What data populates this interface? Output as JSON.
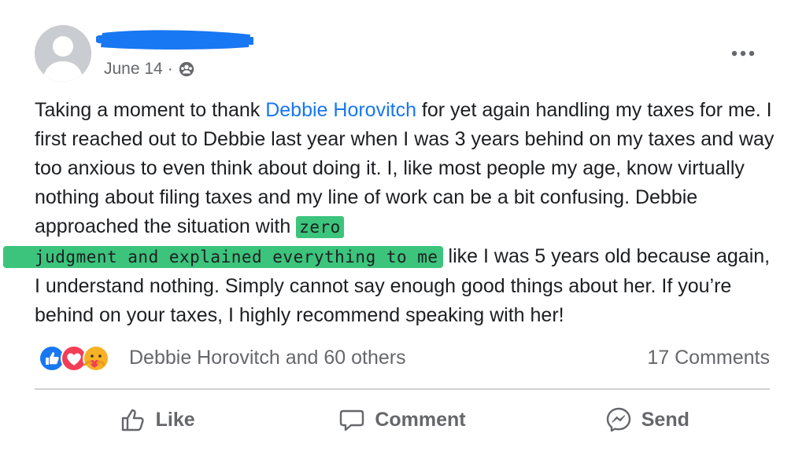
{
  "post": {
    "date": "June 14",
    "separator": "·",
    "text_parts": {
      "p1": "Taking a moment to thank ",
      "mention": "Debbie Horovitch",
      "p2": " for yet again handling my taxes for me. I first reached out to Debbie last year when I was 3 years behind on my taxes and way too anxious to even think about doing it. I, like most people my age, know virtually nothing about filing taxes and my line of work can be a bit confusing. Debbie approached the situation with ",
      "highlight1": "zero",
      "highlight2": "judgment and explained everything to me",
      "p3": " like I was 5 years old because again, I understand nothing.  Simply cannot say enough good things about her. If you’re behind on your taxes, I highly recommend speaking with her!"
    }
  },
  "reactions": {
    "names": "Debbie Horovitch and 60 others",
    "comments": "17 Comments",
    "types": [
      "like",
      "love",
      "care"
    ]
  },
  "actions": {
    "like": "Like",
    "comment": "Comment",
    "send": "Send"
  },
  "colors": {
    "link": "#1877f2",
    "highlight": "#3cc47c",
    "redaction": "#1877f2",
    "muted": "#65676b"
  }
}
